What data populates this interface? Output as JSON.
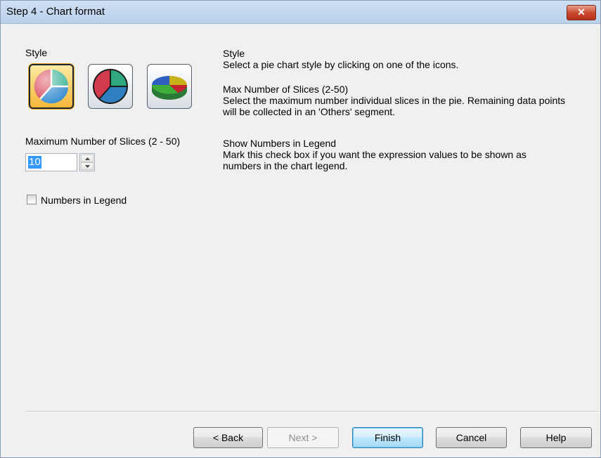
{
  "window": {
    "title": "Step 4 - Chart format",
    "close_glyph": "✕"
  },
  "left": {
    "style_label": "Style",
    "styles": [
      {
        "name": "flat-pie-style",
        "selected": true
      },
      {
        "name": "outlined-pie-style",
        "selected": false
      },
      {
        "name": "3d-pie-style",
        "selected": false
      }
    ],
    "max_slices_label": "Maximum Number of Slices (2 - 50)",
    "max_slices_value": "10",
    "numbers_in_legend_label": "Numbers in Legend",
    "numbers_in_legend_checked": false
  },
  "help": {
    "style_title": "Style",
    "style_body": "Select a pie chart style by clicking on one of the icons.",
    "max_title": "Max Number of Slices (2-50)",
    "max_body_1": "Select the maximum number individual slices in the pie. Remaining data points",
    "max_body_2": "will be collected in an 'Others' segment.",
    "legend_title": "Show Numbers in Legend",
    "legend_body_1": "Mark this check box if you want the expression values to be shown as",
    "legend_body_2": "numbers in the chart legend."
  },
  "buttons": {
    "back": "< Back",
    "next": "Next >",
    "finish": "Finish",
    "cancel": "Cancel",
    "help": "Help"
  },
  "icons": [
    "close-icon",
    "pie-chart-icon",
    "spin-up-icon",
    "spin-down-icon"
  ]
}
